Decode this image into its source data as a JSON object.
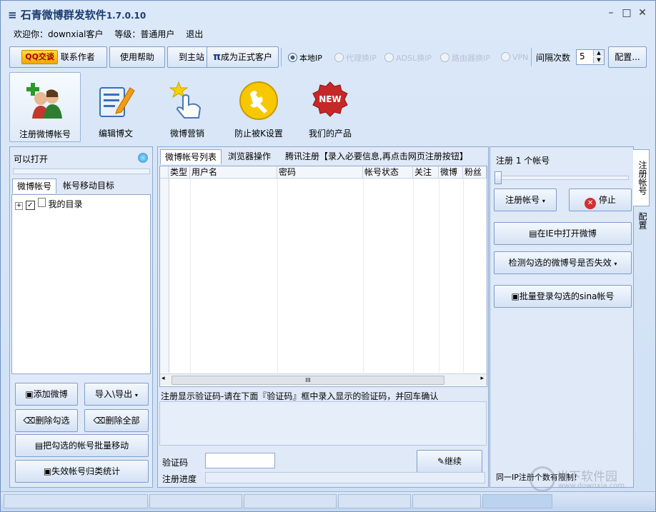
{
  "app": {
    "title": "石青微博群发软件",
    "version": "1.7.0.10"
  },
  "userbar": {
    "welcome": "欢迎你：downxial客户",
    "level": "等级：普通用户",
    "logout": "退出"
  },
  "toolbar": {
    "qq_label": "QQ交谈",
    "contact": "联系作者",
    "help": "使用帮助",
    "home": "到主站",
    "pi": "π",
    "become": "成为正式客户",
    "radios": [
      {
        "label": "本地IP",
        "on": true
      },
      {
        "label": "代理换IP",
        "on": false
      },
      {
        "label": "ADSL换IP",
        "on": false
      },
      {
        "label": "路由器换IP",
        "on": false
      },
      {
        "label": "VPN",
        "on": false
      }
    ],
    "interval_label": "间隔次数",
    "interval_value": "5",
    "config": "配置..."
  },
  "modules": [
    {
      "label": "注册微博帐号"
    },
    {
      "label": "编辑博文"
    },
    {
      "label": "微博营销"
    },
    {
      "label": "防止被K设置"
    },
    {
      "label": "我们的产品"
    }
  ],
  "new_badge": "NEW",
  "left": {
    "open_label": "可以打开",
    "tabs": [
      "微博帐号",
      "帐号移动目标"
    ],
    "tree_root": "我的目录",
    "buttons": {
      "add": "添加微博",
      "import": "导入\\导出",
      "del_sel": "删除勾选",
      "del_all": "删除全部",
      "move": "把勾选的帐号批量移动",
      "stats": "失效帐号归类统计"
    }
  },
  "center": {
    "tabs": [
      "微博帐号列表",
      "浏览器操作",
      "腾讯注册【录入必要信息,再点击网页注册按钮】"
    ],
    "columns": [
      "类型",
      "用户名",
      "密码",
      "帐号状态",
      "关注",
      "微博",
      "粉丝"
    ],
    "scroll_mark": "III",
    "captcha_hint": "注册显示验证码-请在下面『验证码』框中录入显示的验证码，并回车确认",
    "captcha_label": "验证码",
    "continue": "继续",
    "progress_label": "注册进度"
  },
  "right": {
    "register_count": "注册 1 个帐号",
    "register_btn": "注册帐号",
    "stop": "停止",
    "open_ie": "在IE中打开微博",
    "check": "检测勾选的微博号是否失效",
    "batch_login": "批量登录勾选的sina帐号",
    "ip_limit": "同一IP注册个数有限制！",
    "vtabs": [
      "注册帐号",
      "配置"
    ]
  },
  "watermark": {
    "name": "当下软件园",
    "url": "www.downxia.com"
  }
}
